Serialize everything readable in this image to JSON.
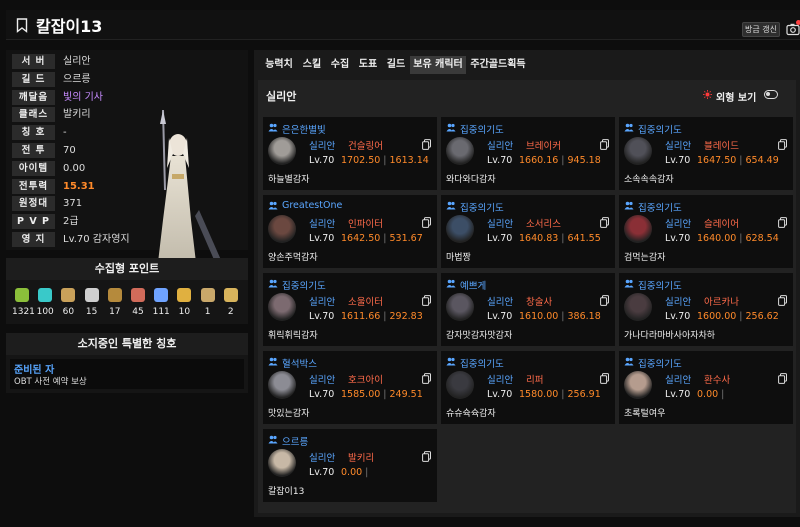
{
  "header": {
    "title": "칼잡이13",
    "renew_label": "방금 갱신"
  },
  "profile": {
    "rows": [
      {
        "label": "서 버",
        "value": "실리안",
        "style": ""
      },
      {
        "label": "길 드",
        "value": "으르릉",
        "style": ""
      },
      {
        "label": "깨달음",
        "value": "빛의 기사",
        "style": "purple"
      },
      {
        "label": "클래스",
        "value": "발키리",
        "style": ""
      },
      {
        "label": "칭 호",
        "value": "-",
        "style": ""
      },
      {
        "label": "전 투",
        "value": "70",
        "style": ""
      },
      {
        "label": "아이템",
        "value": "0.00",
        "style": ""
      },
      {
        "label": "전투력",
        "value": "15.31",
        "style": "orange"
      },
      {
        "label": "원정대",
        "value": "371",
        "style": ""
      },
      {
        "label": "P V P",
        "value": "2급",
        "style": ""
      },
      {
        "label": "영 지",
        "value": "Lv.70 감자영지",
        "style": ""
      }
    ]
  },
  "collection": {
    "title": "수집형 포인트",
    "items": [
      {
        "icon": "mokoko-seed-icon",
        "value": "1321",
        "color": "#8bbf3a"
      },
      {
        "icon": "island-heart-icon",
        "value": "100",
        "color": "#39c9c9"
      },
      {
        "icon": "great-art-icon",
        "value": "60",
        "color": "#c9a15a"
      },
      {
        "icon": "giant-heart-icon",
        "value": "15",
        "color": "#cfcfcf"
      },
      {
        "icon": "ignea-token-icon",
        "value": "17",
        "color": "#b58a3c"
      },
      {
        "icon": "orpheus-star-icon",
        "value": "45",
        "color": "#d16b5a"
      },
      {
        "icon": "world-tree-leaf-icon",
        "value": "111",
        "color": "#6fa3ff"
      },
      {
        "icon": "sea-bounty-icon",
        "value": "10",
        "color": "#e0b040"
      },
      {
        "icon": "musical-note-icon",
        "value": "1",
        "color": "#c9a86a"
      },
      {
        "icon": "adventure-map-icon",
        "value": "2",
        "color": "#d8b45c"
      }
    ]
  },
  "titles": {
    "title": "소지중인 특별한 칭호",
    "name": "준비된 자",
    "desc": "OBT 사전 예약 보상"
  },
  "tabs": [
    "능력치",
    "스킬",
    "수집",
    "도표",
    "길드",
    "보유 캐릭터",
    "주간골드획득"
  ],
  "roster": {
    "server": "실리안",
    "view_toggle_label": "외형 보기",
    "cards": [
      {
        "guild": "은은한별빛",
        "server": "실리안",
        "class": "건슬링어",
        "lv": "Lv.70",
        "item_level": "1702.50",
        "power": "1613.14",
        "name": "하늘별감자",
        "avatar": "#a09c98"
      },
      {
        "guild": "집중의기도",
        "server": "실리안",
        "class": "브레이커",
        "lv": "Lv.70",
        "item_level": "1660.16",
        "power": "945.18",
        "name": "와다와다감자",
        "avatar": "#6a6a70"
      },
      {
        "guild": "집중의기도",
        "server": "실리안",
        "class": "블레이드",
        "lv": "Lv.70",
        "item_level": "1647.50",
        "power": "654.49",
        "name": "소속속속감자",
        "avatar": "#505058"
      },
      {
        "guild": "GreatestOne",
        "server": "실리안",
        "class": "인파이터",
        "lv": "Lv.70",
        "item_level": "1642.50",
        "power": "531.67",
        "name": "양손주먹감자",
        "avatar": "#6b4840"
      },
      {
        "guild": "집중의기도",
        "server": "실리안",
        "class": "소서리스",
        "lv": "Lv.70",
        "item_level": "1640.83",
        "power": "641.55",
        "name": "마법짱",
        "avatar": "#3c4e66"
      },
      {
        "guild": "집중의기도",
        "server": "실리안",
        "class": "슬레이어",
        "lv": "Lv.70",
        "item_level": "1640.00",
        "power": "628.54",
        "name": "검먹는감자",
        "avatar": "#8a2f36"
      },
      {
        "guild": "집중의기도",
        "server": "실리안",
        "class": "소울이터",
        "lv": "Lv.70",
        "item_level": "1611.66",
        "power": "292.83",
        "name": "휘릭휘릭감자",
        "avatar": "#7c6a70"
      },
      {
        "guild": "예쁘게",
        "server": "실리안",
        "class": "창술사",
        "lv": "Lv.70",
        "item_level": "1610.00",
        "power": "386.18",
        "name": "감자맛감자맛감자",
        "avatar": "#5a5660"
      },
      {
        "guild": "집중의기도",
        "server": "실리안",
        "class": "아르카나",
        "lv": "Lv.70",
        "item_level": "1600.00",
        "power": "256.62",
        "name": "가나다라마바사아자차하",
        "avatar": "#4a3c40"
      },
      {
        "guild": "혈석박스",
        "server": "실리안",
        "class": "호크아이",
        "lv": "Lv.70",
        "item_level": "1585.00",
        "power": "249.51",
        "name": "맛있는감자",
        "avatar": "#8c8c94"
      },
      {
        "guild": "집중의기도",
        "server": "실리안",
        "class": "리퍼",
        "lv": "Lv.70",
        "item_level": "1580.00",
        "power": "256.91",
        "name": "슈슈슉슉감자",
        "avatar": "#3a3a40"
      },
      {
        "guild": "집중의기도",
        "server": "실리안",
        "class": "환수사",
        "lv": "Lv.70",
        "item_level": "0.00",
        "power": "",
        "name": "초록털여우",
        "avatar": "#b59c8e"
      },
      {
        "guild": "으르릉",
        "server": "실리안",
        "class": "발키리",
        "lv": "Lv.70",
        "item_level": "0.00",
        "power": "",
        "name": "칼잡이13",
        "avatar": "#c7b8a6"
      }
    ]
  }
}
